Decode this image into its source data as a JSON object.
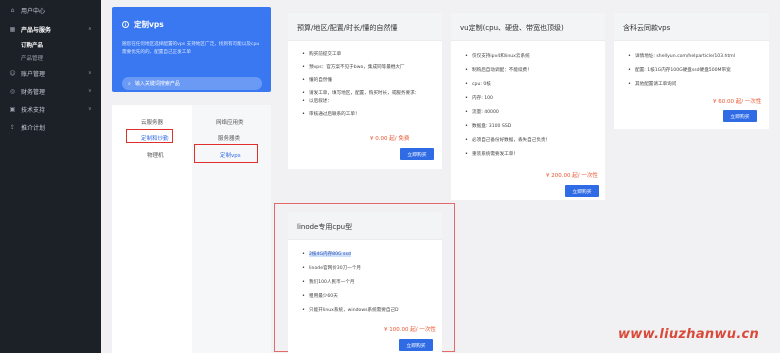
{
  "sidebar": {
    "items": [
      {
        "label": "用户中心",
        "icon": "house-icon",
        "chevron": ""
      },
      {
        "label": "产品与服务",
        "icon": "grid-icon",
        "chevron": "∧"
      },
      {
        "label": "账户管理",
        "icon": "user-icon",
        "chevron": "∨"
      },
      {
        "label": "财务管理",
        "icon": "wallet-icon",
        "chevron": "∨"
      },
      {
        "label": "技术支持",
        "icon": "headset-icon",
        "chevron": "∨"
      },
      {
        "label": "推介计划",
        "icon": "share-icon",
        "chevron": ""
      }
    ],
    "sub_items": [
      {
        "label": "订购产品",
        "active": true
      },
      {
        "label": "产品管理",
        "active": false
      }
    ]
  },
  "search_card": {
    "title": "定制vps",
    "description": "随您在任何地区选择配置的vps 支持地区广泛，找到有可能以及cpu需要优先的的、配置自己正发工单",
    "search_placeholder": "输入关键词搜索产品",
    "accent": "#3a78f2"
  },
  "categories": {
    "left": [
      "云服务器",
      "定制和炒勤",
      "物理机"
    ],
    "right": [
      "网络应用类",
      "服务器类",
      "定制vps"
    ]
  },
  "cards": [
    {
      "title": "预算/地区/配置/时长/懂的自然懂",
      "features": [
        "购买前提交工单",
        "预vps：官方案不见于bwo，集成同等最棍大厂",
        "懂的自然懂",
        "请发工单，填写地区，配置，购买时长，或服务要求：",
        "以后叙述：",
        "审核通过后联系的工单！"
      ],
      "price": "¥ 0.00 起/ 免费",
      "buy_label": "立即购买"
    },
    {
      "title": "vu定制(cpu、硬盘、带宽也顶级)",
      "features": [
        "仅仅支持ipv4和linux云系统",
        "制购后自动调配：不能续费！",
        "cpu: 0核",
        "内存: 100",
        "流量: 40000",
        "数据盘: 3100 SSD",
        "必须自己备份好数据，丢失自己负责！",
        "重装系统需要发工单！"
      ],
      "price": "¥ 200.00 起/ 一次性",
      "buy_label": "立即购买"
    },
    {
      "title": "含科云同款vps",
      "features": [
        "详情地址: shellyun.com/helparticle/103.html",
        "配置: 1核1G内存100G硬盘ssd硬盘500M带宽",
        "其他配置请工单询问"
      ],
      "price": "¥ 60.00 起/ 一次性",
      "buy_label": "立即购买"
    },
    {
      "title": "linode专用cpu型",
      "features": [
        "2核4G内存80G ssd",
        "linode官网价30刀一个月",
        "我们100人民币一个月",
        "租用最少60天",
        "只能开linux系统，windows系统需要自己D"
      ],
      "price": "¥ 100.00 起/ 一次性",
      "buy_label": "立即购买"
    }
  ],
  "watermark": "www.liuzhanwu.cn",
  "colors": {
    "sidebar_bg": "#1c2128",
    "accent": "#2f6be5",
    "price": "#e8542e",
    "highlight": "#e0302c"
  }
}
